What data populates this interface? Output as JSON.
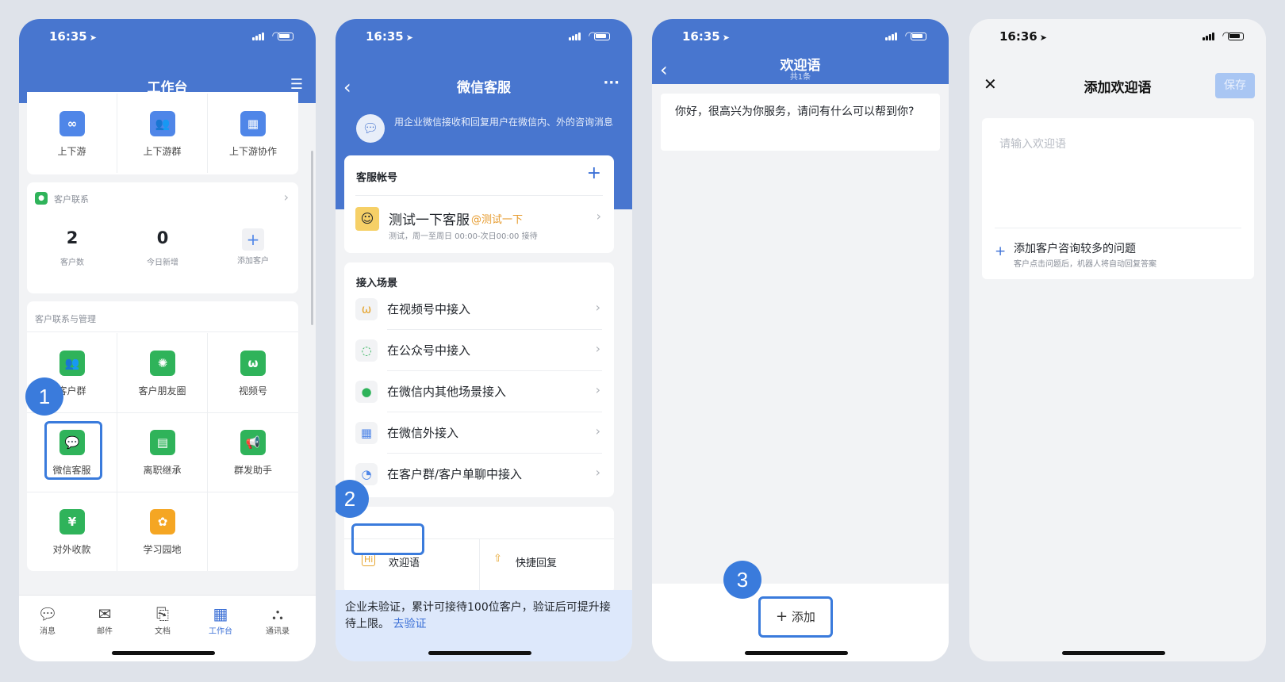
{
  "phone1": {
    "time": "16:35",
    "title": "工作台",
    "top_items": [
      {
        "label": "上下游",
        "icon": "link-icon"
      },
      {
        "label": "上下游群",
        "icon": "group-icon"
      },
      {
        "label": "上下游协作",
        "icon": "grid-icon"
      }
    ],
    "customer_contact": {
      "title": "客户联系",
      "stats": [
        {
          "value": "2",
          "label": "客户数"
        },
        {
          "value": "0",
          "label": "今日新增"
        },
        {
          "value": "+",
          "label": "添加客户"
        }
      ]
    },
    "section_title": "客户联系与管理",
    "apps": [
      {
        "label": "客户群",
        "icon": "customer-group-icon",
        "color": "#2fb35a"
      },
      {
        "label": "客户朋友圈",
        "icon": "moments-icon",
        "color": "#2fb35a"
      },
      {
        "label": "视频号",
        "icon": "channels-icon",
        "color": "#2fb35a"
      },
      {
        "label": "微信客服",
        "icon": "wechat-service-icon",
        "color": "#2fb35a"
      },
      {
        "label": "离职继承",
        "icon": "inherit-icon",
        "color": "#2fb35a"
      },
      {
        "label": "群发助手",
        "icon": "broadcast-icon",
        "color": "#2fb35a"
      },
      {
        "label": "对外收款",
        "icon": "payment-icon",
        "color": "#2fb35a"
      },
      {
        "label": "学习园地",
        "icon": "learning-icon",
        "color": "#f5a623"
      }
    ],
    "tabs": [
      {
        "label": "消息",
        "icon": "chat-bubble-icon",
        "active": false
      },
      {
        "label": "邮件",
        "icon": "mail-icon",
        "active": false
      },
      {
        "label": "文档",
        "icon": "document-icon",
        "active": false
      },
      {
        "label": "工作台",
        "icon": "workbench-icon",
        "active": true
      },
      {
        "label": "通讯录",
        "icon": "contacts-icon",
        "active": false
      }
    ],
    "step": "1"
  },
  "phone2": {
    "time": "16:35",
    "title": "微信客服",
    "info": "用企业微信接收和回复用户在微信内、外的咨询消息",
    "accounts": {
      "title": "客服帐号",
      "name": "测试一下客服",
      "tag": "@测试一下",
      "detail": "测试，周一至周日 00:00-次日00:00 接待"
    },
    "scenes": {
      "title": "接入场景",
      "items": [
        {
          "label": "在视频号中接入",
          "icon": "channels-icon"
        },
        {
          "label": "在公众号中接入",
          "icon": "official-account-icon"
        },
        {
          "label": "在微信内其他场景接入",
          "icon": "wechat-icon"
        },
        {
          "label": "在微信外接入",
          "icon": "apps-icon"
        },
        {
          "label": "在客户群/客户单聊中接入",
          "icon": "group-chat-icon"
        }
      ]
    },
    "tools": [
      {
        "label": "欢迎语",
        "icon": "hi-icon"
      },
      {
        "label": "快捷回复",
        "icon": "quick-reply-icon"
      }
    ],
    "notice": "企业未验证，累计可接待100位客户，验证后可提升接待上限。",
    "notice_link": "去验证",
    "step": "2"
  },
  "phone3": {
    "time": "16:35",
    "title": "欢迎语",
    "subtitle": "共1条",
    "message": "你好，很高兴为你服务，请问有什么可以帮到你?",
    "add_label": "添加",
    "step": "3"
  },
  "phone4": {
    "time": "16:36",
    "title": "添加欢迎语",
    "save_label": "保存",
    "placeholder": "请输入欢迎语",
    "add_question": "添加客户咨询较多的问题",
    "add_question_desc": "客户点击问题后，机器人将自动回复答案"
  }
}
